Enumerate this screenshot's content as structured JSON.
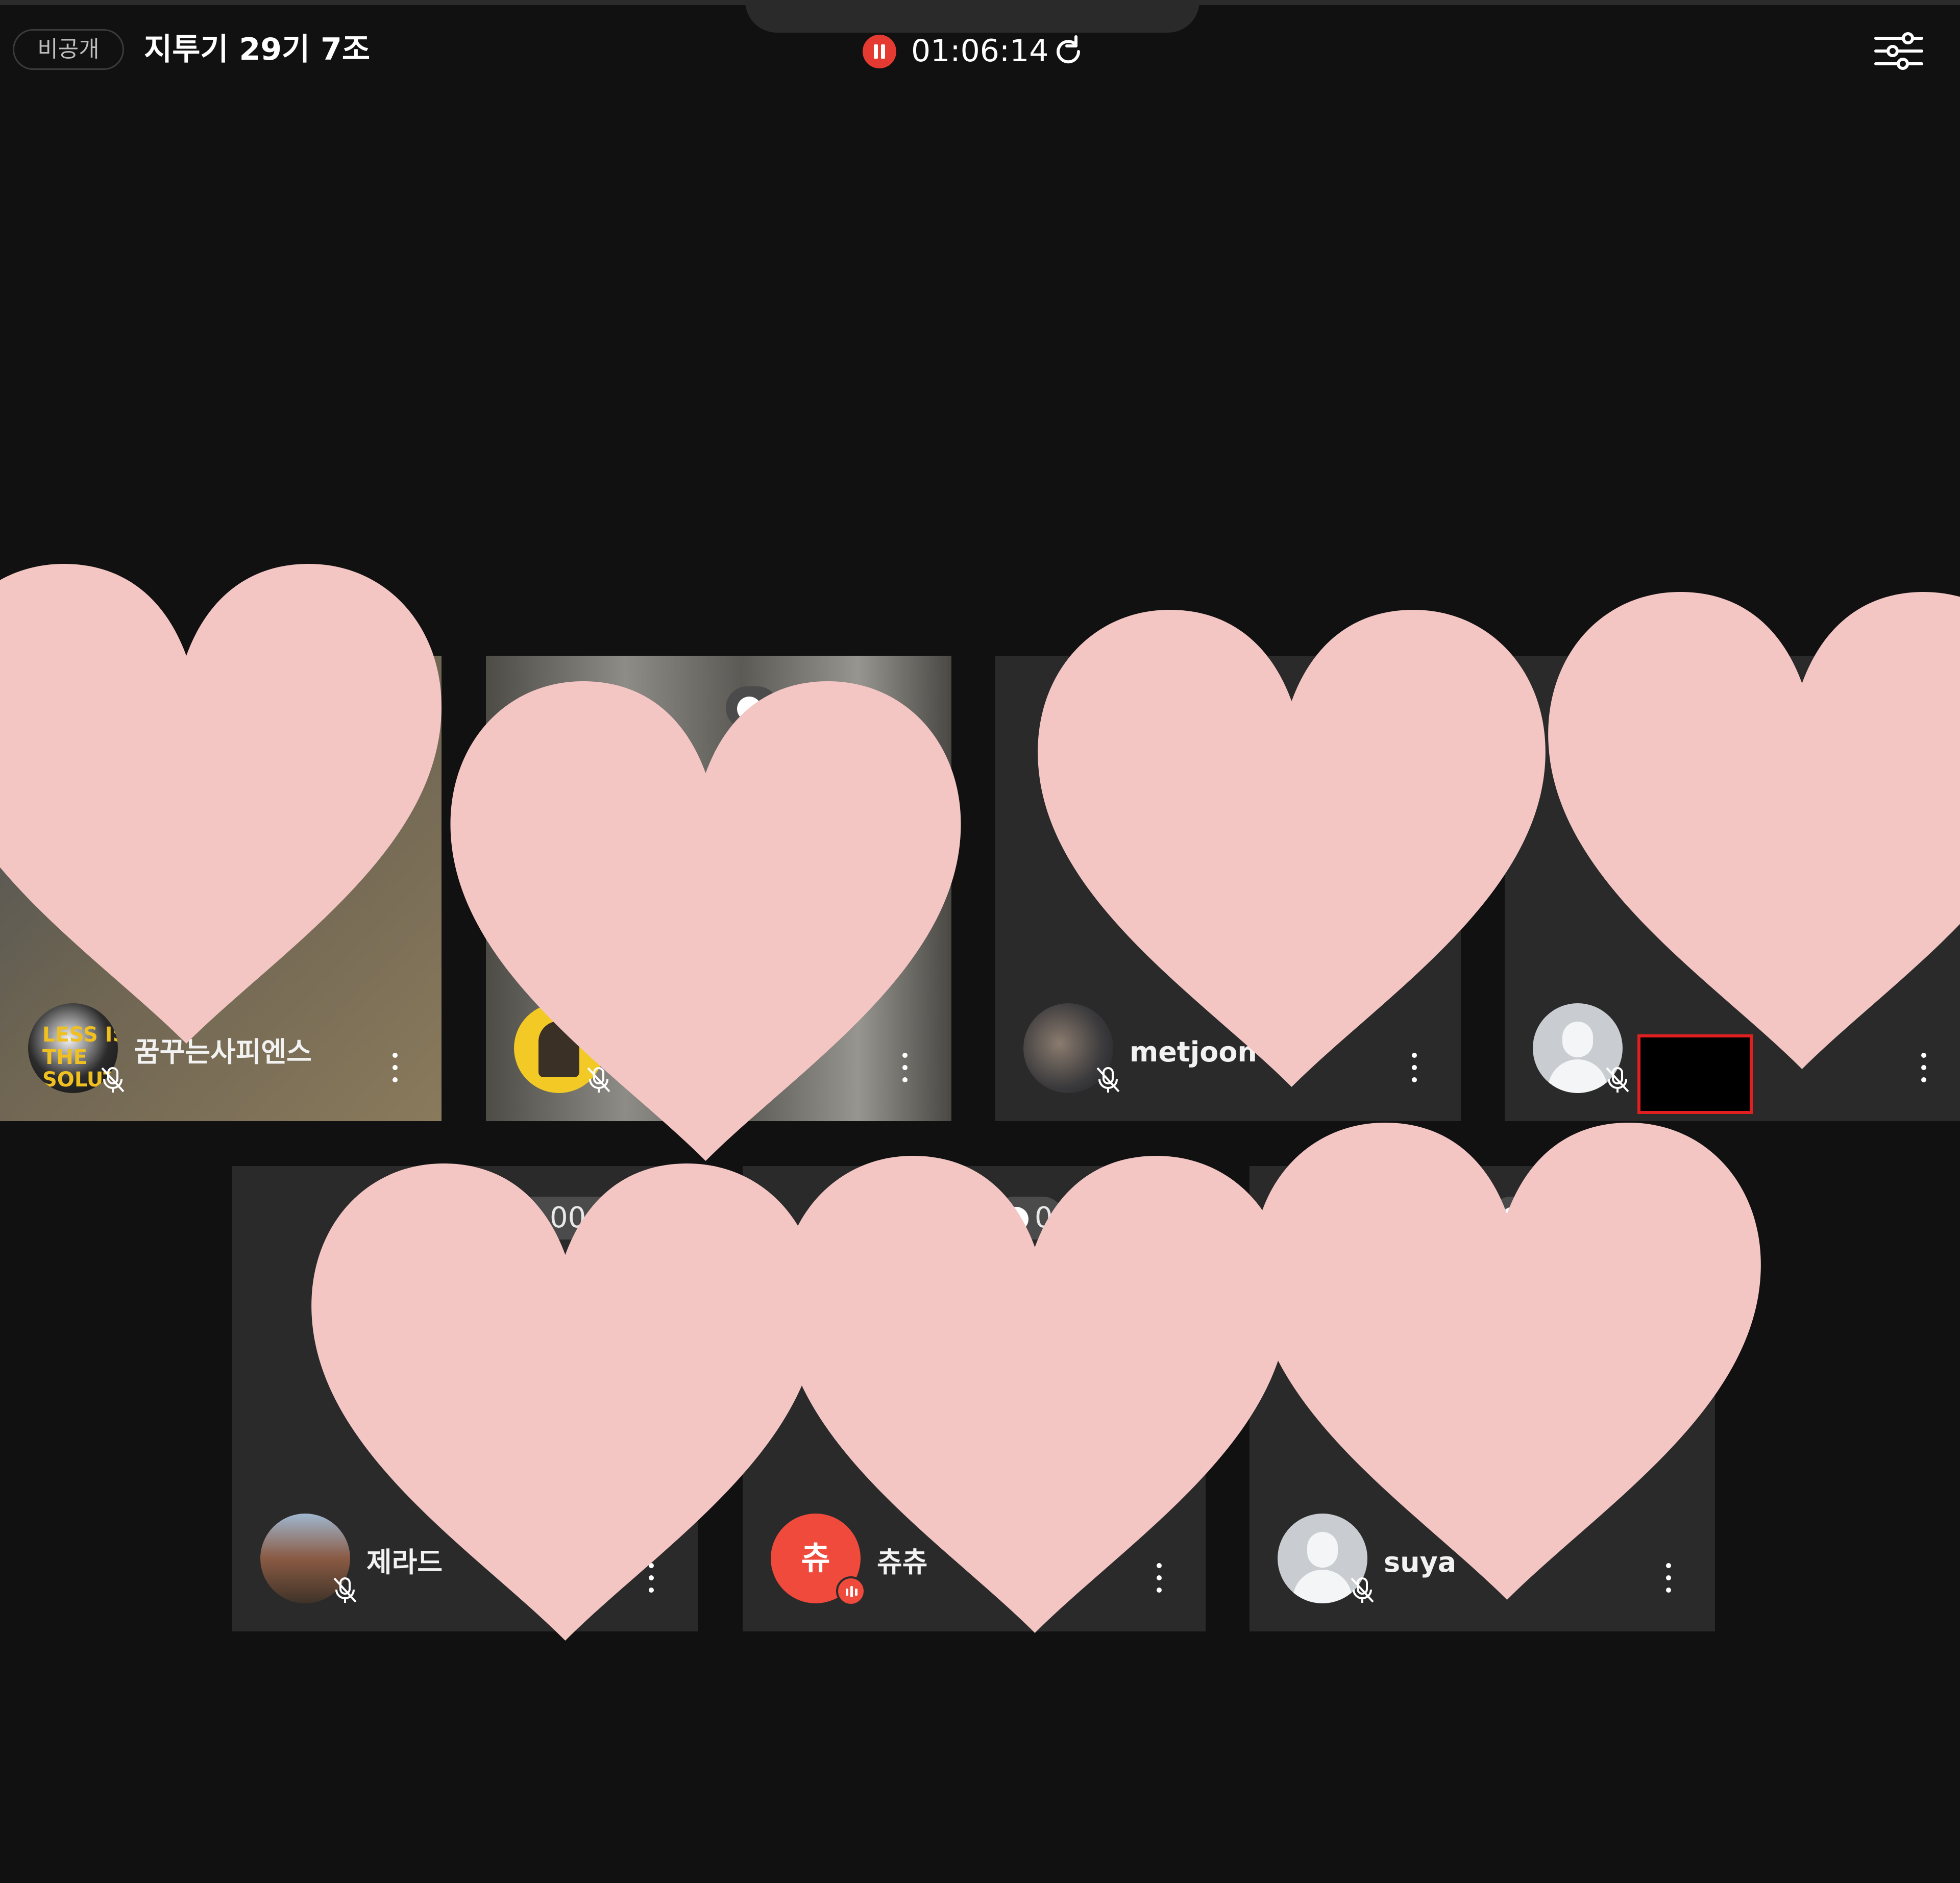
{
  "header": {
    "visibility_badge": "비공개",
    "room_title": "지투기 29기 7조",
    "elapsed_time": "01:06:14"
  },
  "participants": [
    {
      "name": "꿈꾸는사피엔스",
      "avatar_text": "LESS IS THE SOLUTION",
      "mic": "muted"
    },
    {
      "name": "",
      "mic": "muted"
    },
    {
      "name": "metjoon",
      "mic": "muted"
    },
    {
      "name": "",
      "mic": "muted"
    },
    {
      "name": "제라드",
      "mic": "muted",
      "timer_partial": "00:5"
    },
    {
      "name": "츄츄",
      "avatar_text": "츄",
      "mic": "speaking",
      "timer_partial": "0"
    },
    {
      "name": "suya",
      "mic": "muted"
    }
  ],
  "colors": {
    "background": "#111111",
    "tile": "#2a2a2a",
    "accent_red": "#e53a32",
    "overlay_heart": "#f3c6c4"
  },
  "icons": [
    "record-pause-icon",
    "refresh-icon",
    "settings-sliders-icon",
    "mic-off-icon",
    "more-vertical-icon",
    "heart-overlay"
  ]
}
